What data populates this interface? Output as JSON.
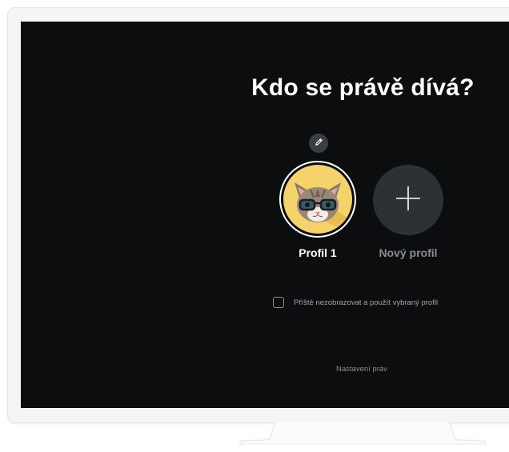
{
  "screen": {
    "title": "Kdo se právě dívá?"
  },
  "profiles": [
    {
      "label": "Profil 1",
      "avatar": "cat-with-glasses-avatar",
      "selected": true
    },
    {
      "label": "Nový profil",
      "icon": "plus-icon",
      "selected": false
    }
  ],
  "edit": {
    "icon": "pencil-icon"
  },
  "remember": {
    "label": "Příště nezobrazovat a použít vybraný profil",
    "checked": false
  },
  "settings_link": {
    "label": "Nastavení práv"
  },
  "colors": {
    "screen_bg": "#0c0d0f",
    "avatar_bg": "#f6d36a",
    "new_profile_bg": "#2d3035",
    "active_text": "#ffffff",
    "muted_text": "#8a8d92"
  }
}
